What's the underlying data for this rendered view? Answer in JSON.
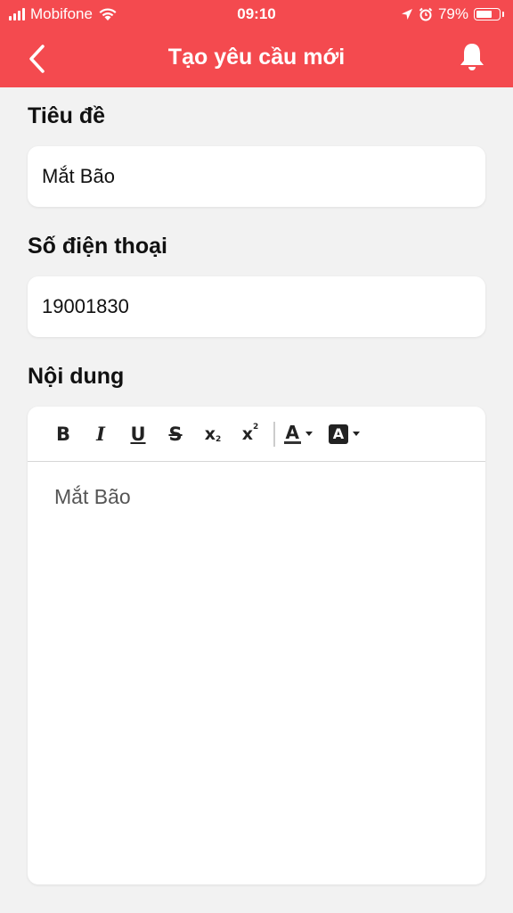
{
  "status_bar": {
    "carrier": "Mobifone",
    "time": "09:10",
    "battery": "79%",
    "battery_level": 0.79
  },
  "nav": {
    "title": "Tạo yêu cầu mới",
    "back_icon": "chevron-left-icon",
    "bell_icon": "bell-icon"
  },
  "form": {
    "title_label": "Tiêu đề",
    "title_value": "Mắt Bão",
    "phone_label": "Số điện thoại",
    "phone_value": "19001830",
    "content_label": "Nội dung",
    "content_value": "Mắt Bão"
  },
  "toolbar": {
    "bold": "B",
    "italic": "I",
    "underline": "U",
    "strike": "S",
    "subscript": "x",
    "subscript_small": "2",
    "superscript": "x",
    "superscript_small": "2",
    "font_color": "A",
    "bg_color": "A"
  },
  "colors": {
    "header": "#f44a4f",
    "background": "#f2f2f2"
  }
}
